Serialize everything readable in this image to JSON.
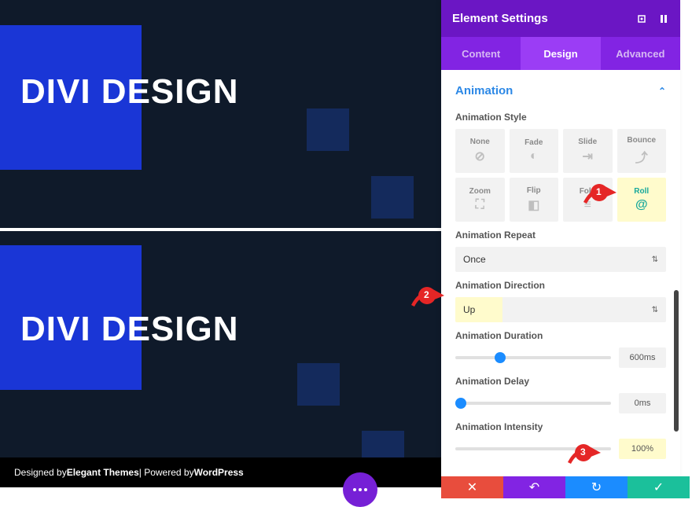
{
  "canvas": {
    "title": "DIVI DESIGN"
  },
  "footer": {
    "prefix": "Designed by ",
    "brand1": "Elegant Themes",
    "mid": " | Powered by ",
    "brand2": "WordPress"
  },
  "panel": {
    "title": "Element Settings",
    "tabs": {
      "content": "Content",
      "design": "Design",
      "advanced": "Advanced"
    },
    "section": "Animation",
    "labels": {
      "style": "Animation Style",
      "repeat": "Animation Repeat",
      "direction": "Animation Direction",
      "duration": "Animation Duration",
      "delay": "Animation Delay",
      "intensity": "Animation Intensity"
    },
    "styles": [
      "None",
      "Fade",
      "Slide",
      "Bounce",
      "Zoom",
      "Flip",
      "Fold",
      "Roll"
    ],
    "repeat_value": "Once",
    "direction_value": "Up",
    "duration_value": "600ms",
    "delay_value": "0ms",
    "intensity_value": "100%"
  },
  "callouts": {
    "one": "1",
    "two": "2",
    "three": "3"
  }
}
